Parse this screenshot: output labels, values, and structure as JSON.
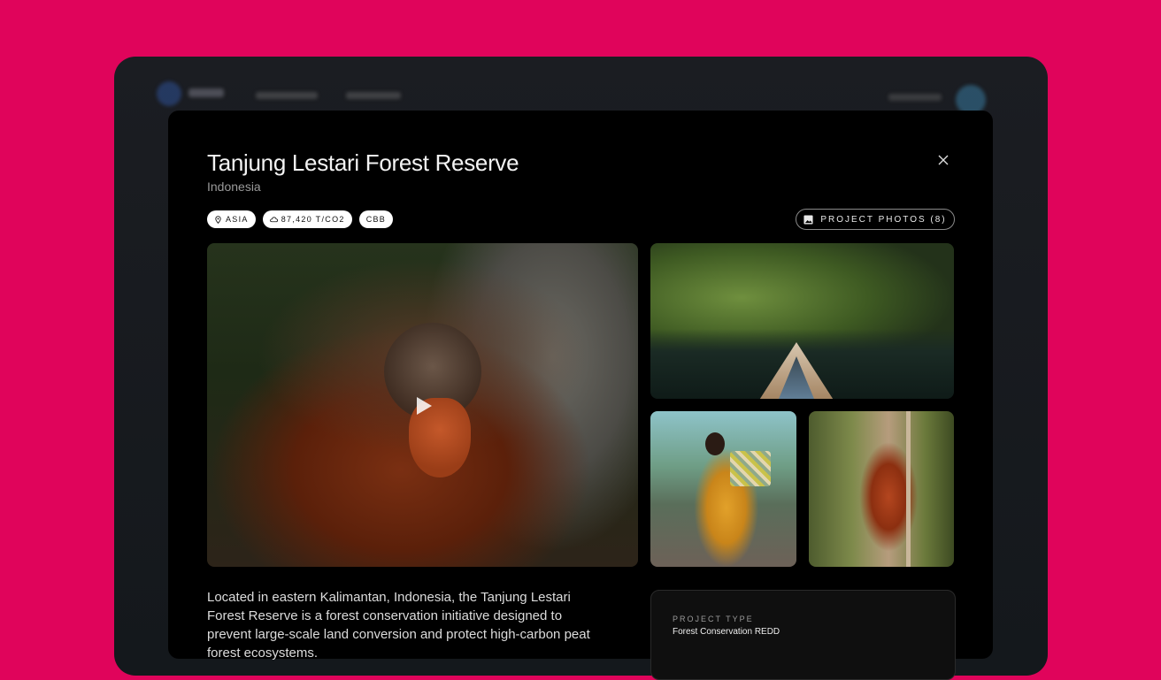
{
  "modal": {
    "title": "Tanjung Lestari Forest Reserve",
    "subtitle": "Indonesia",
    "close_icon": "close-icon",
    "tags": [
      {
        "icon": "location-pin-icon",
        "label": "ASIA"
      },
      {
        "icon": "cloud-icon",
        "label": "87,420 T/CO2"
      },
      {
        "icon": null,
        "label": "CBB"
      }
    ],
    "photos_button": {
      "icon": "image-icon",
      "label": "PROJECT PHOTOS (8)"
    },
    "photos": {
      "main": {
        "subject": "orangutan",
        "icon": "play-icon"
      },
      "secondary": [
        "river-boat",
        "woman-with-basket",
        "orangutan-climbing"
      ]
    },
    "description": "Located in eastern Kalimantan, Indonesia, the Tanjung Lestari Forest Reserve is a forest conservation initiative designed to prevent large-scale land conversion and protect high-carbon peat forest ecosystems.",
    "info": {
      "label": "PROJECT TYPE",
      "value": "Forest Conservation REDD"
    }
  },
  "colors": {
    "background": "#e0045b",
    "modal": "#000000",
    "tag_bg": "#ffffff"
  }
}
